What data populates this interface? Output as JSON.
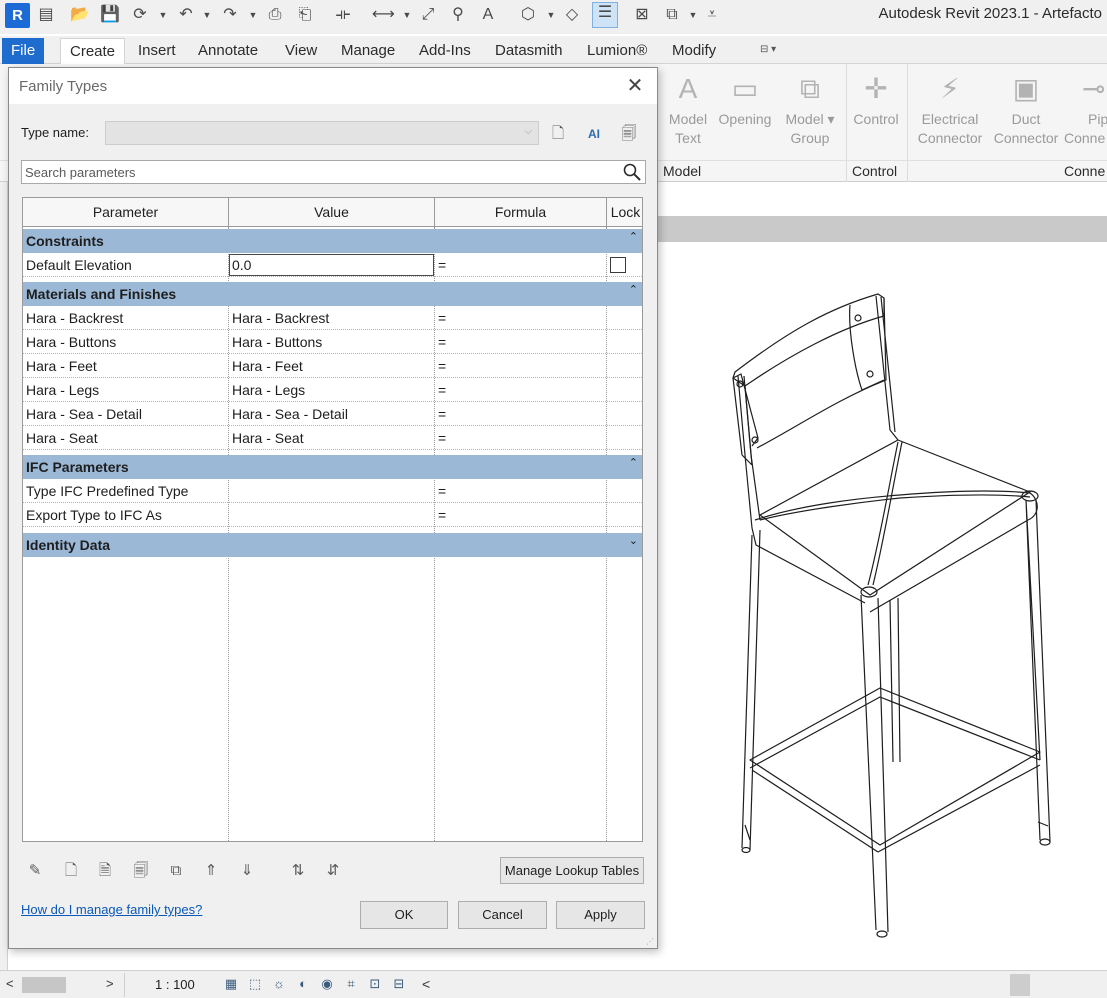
{
  "app": {
    "title": "Autodesk Revit 2023.1 - Artefacto",
    "logo_letter": "R"
  },
  "ribbon": {
    "tabs": [
      "File",
      "Create",
      "Insert",
      "Annotate",
      "View",
      "Manage",
      "Add-Ins",
      "Datasmith",
      "Lumion®",
      "Modify"
    ],
    "buttons": [
      {
        "label1": "Model",
        "label2": "Text"
      },
      {
        "label1": "Opening",
        "label2": ""
      },
      {
        "label1": "Model",
        "label2": "Group"
      },
      {
        "label1": "Control",
        "label2": ""
      },
      {
        "label1": "Electrical",
        "label2": "Connector"
      },
      {
        "label1": "Duct",
        "label2": "Connector"
      },
      {
        "label1": "Pip",
        "label2": "Conne"
      }
    ],
    "panels": [
      "Model",
      "Control",
      "Conne"
    ]
  },
  "dialog": {
    "title": "Family Types",
    "type_name_label": "Type name:",
    "type_name_value": "",
    "search_placeholder": "Search parameters",
    "columns": [
      "Parameter",
      "Value",
      "Formula",
      "Lock"
    ],
    "groups": [
      {
        "name": "Constraints",
        "toggle": "⌃",
        "rows": [
          {
            "parameter": "Default Elevation",
            "value": "0.0",
            "formula": "=",
            "lock": false
          }
        ]
      },
      {
        "name": "Materials and Finishes",
        "toggle": "⌃",
        "rows": [
          {
            "parameter": "Hara - Backrest",
            "value": "Hara - Backrest",
            "formula": "="
          },
          {
            "parameter": "Hara - Buttons",
            "value": "Hara - Buttons",
            "formula": "="
          },
          {
            "parameter": "Hara - Feet",
            "value": "Hara - Feet",
            "formula": "="
          },
          {
            "parameter": "Hara - Legs",
            "value": "Hara - Legs",
            "formula": "="
          },
          {
            "parameter": "Hara - Sea - Detail",
            "value": "Hara - Sea - Detail",
            "formula": "="
          },
          {
            "parameter": "Hara - Seat",
            "value": "Hara - Seat",
            "formula": "="
          }
        ]
      },
      {
        "name": "IFC Parameters",
        "toggle": "⌃",
        "rows": [
          {
            "parameter": "Type IFC Predefined Type",
            "value": "",
            "formula": "="
          },
          {
            "parameter": "Export Type to IFC As",
            "value": "",
            "formula": "="
          }
        ]
      },
      {
        "name": "Identity Data",
        "toggle": "⌄",
        "rows": []
      }
    ],
    "manage_lookup_label": "Manage Lookup Tables",
    "help_link": "How do I manage family types?",
    "ok_label": "OK",
    "cancel_label": "Cancel",
    "apply_label": "Apply"
  },
  "status": {
    "scale": "1 : 100"
  }
}
